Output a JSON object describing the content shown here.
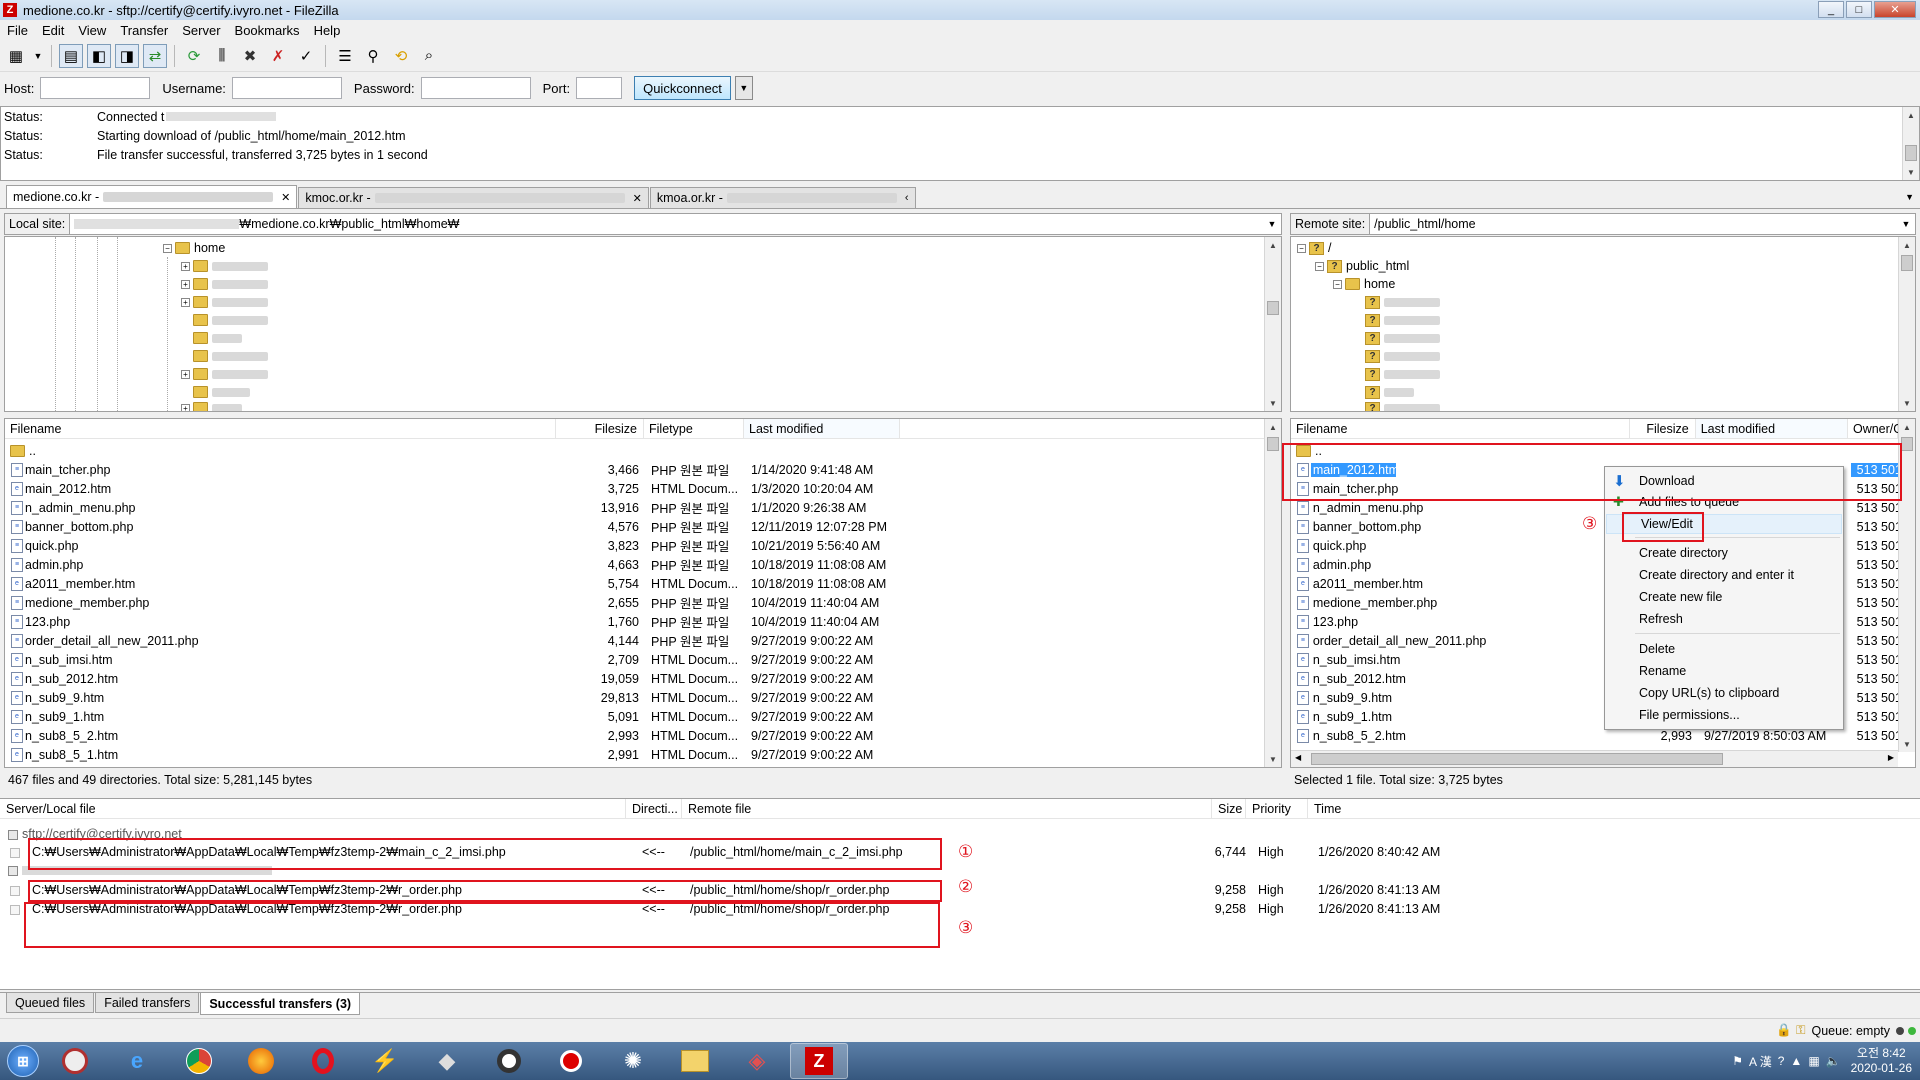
{
  "window": {
    "title": "medione.co.kr - sftp://certify@certify.ivyro.net - FileZilla",
    "app_icon": "filezilla-icon",
    "controls": [
      "_",
      "□",
      "✕"
    ]
  },
  "menu": [
    "File",
    "Edit",
    "View",
    "Transfer",
    "Server",
    "Bookmarks",
    "Help"
  ],
  "quickconnect": {
    "host_label": "Host:",
    "username_label": "Username:",
    "password_label": "Password:",
    "port_label": "Port:",
    "button": "Quickconnect",
    "dropdown": "▼"
  },
  "message_log": [
    {
      "k": "Status:",
      "v": "Connected t"
    },
    {
      "k": "Status:",
      "v": "Starting download of /public_html/home/main_2012.htm"
    },
    {
      "k": "Status:",
      "v": "File transfer successful, transferred 3,725 bytes in 1 second"
    }
  ],
  "site_tabs": [
    {
      "label": "medione.co.kr -",
      "close": "✕"
    },
    {
      "label": "kmoc.or.kr -",
      "close": "✕"
    },
    {
      "label": "kmoa.or.kr -",
      "close": "‹"
    }
  ],
  "local": {
    "site_label": "Local site:",
    "site_path": "₩medione.co.kr₩public_html₩home₩",
    "tree_home": "home",
    "headers": [
      "Filename",
      "Filesize",
      "Filetype",
      "Last modified"
    ],
    "parent": "..",
    "files": [
      {
        "name": "main_tcher.php",
        "size": "3,466",
        "type": "PHP 원본 파일",
        "modified": "1/14/2020 9:41:48 AM"
      },
      {
        "name": "main_2012.htm",
        "size": "3,725",
        "type": "HTML Docum...",
        "modified": "1/3/2020 10:20:04 AM"
      },
      {
        "name": "n_admin_menu.php",
        "size": "13,916",
        "type": "PHP 원본 파일",
        "modified": "1/1/2020 9:26:38 AM"
      },
      {
        "name": "banner_bottom.php",
        "size": "4,576",
        "type": "PHP 원본 파일",
        "modified": "12/11/2019 12:07:28 PM"
      },
      {
        "name": "quick.php",
        "size": "3,823",
        "type": "PHP 원본 파일",
        "modified": "10/21/2019 5:56:40 AM"
      },
      {
        "name": "admin.php",
        "size": "4,663",
        "type": "PHP 원본 파일",
        "modified": "10/18/2019 11:08:08 AM"
      },
      {
        "name": "a2011_member.htm",
        "size": "5,754",
        "type": "HTML Docum...",
        "modified": "10/18/2019 11:08:08 AM"
      },
      {
        "name": "medione_member.php",
        "size": "2,655",
        "type": "PHP 원본 파일",
        "modified": "10/4/2019 11:40:04 AM"
      },
      {
        "name": "123.php",
        "size": "1,760",
        "type": "PHP 원본 파일",
        "modified": "10/4/2019 11:40:04 AM"
      },
      {
        "name": "order_detail_all_new_2011.php",
        "size": "4,144",
        "type": "PHP 원본 파일",
        "modified": "9/27/2019 9:00:22 AM"
      },
      {
        "name": "n_sub_imsi.htm",
        "size": "2,709",
        "type": "HTML Docum...",
        "modified": "9/27/2019 9:00:22 AM"
      },
      {
        "name": "n_sub_2012.htm",
        "size": "19,059",
        "type": "HTML Docum...",
        "modified": "9/27/2019 9:00:22 AM"
      },
      {
        "name": "n_sub9_9.htm",
        "size": "29,813",
        "type": "HTML Docum...",
        "modified": "9/27/2019 9:00:22 AM"
      },
      {
        "name": "n_sub9_1.htm",
        "size": "5,091",
        "type": "HTML Docum...",
        "modified": "9/27/2019 9:00:22 AM"
      },
      {
        "name": "n_sub8_5_2.htm",
        "size": "2,993",
        "type": "HTML Docum...",
        "modified": "9/27/2019 9:00:22 AM"
      },
      {
        "name": "n_sub8_5_1.htm",
        "size": "2,991",
        "type": "HTML Docum...",
        "modified": "9/27/2019 9:00:22 AM"
      }
    ],
    "status": "467 files and 49 directories. Total size: 5,281,145 bytes"
  },
  "remote": {
    "site_label": "Remote site:",
    "site_path": "/public_html/home",
    "tree": {
      "root": "/",
      "public_html": "public_html",
      "home": "home"
    },
    "headers": [
      "Filename",
      "Filesize",
      "Last modified",
      "Owner/G"
    ],
    "parent": "..",
    "files": [
      {
        "name": "main_2012.htm",
        "owner": "513 501"
      },
      {
        "name": "main_tcher.php",
        "owner": "513 501"
      },
      {
        "name": "n_admin_menu.php",
        "owner": "513 501"
      },
      {
        "name": "banner_bottom.php",
        "owner": "513 501"
      },
      {
        "name": "quick.php",
        "owner": "513 501"
      },
      {
        "name": "admin.php",
        "owner": "513 501"
      },
      {
        "name": "a2011_member.htm",
        "owner": "513 501"
      },
      {
        "name": "medione_member.php",
        "owner": "513 501"
      },
      {
        "name": "123.php",
        "owner": "513 501"
      },
      {
        "name": "order_detail_all_new_2011.php",
        "owner": "513 501"
      },
      {
        "name": "n_sub_imsi.htm",
        "owner": "513 501"
      },
      {
        "name": "n_sub_2012.htm",
        "owner": "513 501"
      },
      {
        "name": "n_sub9_9.htm",
        "owner": "513 501"
      },
      {
        "name": "n_sub9_1.htm",
        "owner": "513 501"
      },
      {
        "name": "n_sub8_5_2.htm",
        "owner": "513 501",
        "size": "2,993",
        "modified": "9/27/2019 8:50:03 AM"
      }
    ],
    "status": "Selected 1 file. Total size: 3,725 bytes"
  },
  "context_menu": {
    "items": [
      "Download",
      "Add files to queue",
      "View/Edit",
      "Create directory",
      "Create directory and enter it",
      "Create new file",
      "Refresh",
      "Delete",
      "Rename",
      "Copy URL(s) to clipboard",
      "File permissions..."
    ]
  },
  "queue": {
    "headers": [
      "Server/Local file",
      "Directi...",
      "Remote file",
      "Size",
      "Priority",
      "Time"
    ],
    "server": "sftp://certify@certify.ivyro.net",
    "rows": [
      {
        "local": "C:₩Users₩Administrator₩AppData₩Local₩Temp₩fz3temp-2₩main_c_2_imsi.php",
        "dir": "<<--",
        "remote": "/public_html/home/main_c_2_imsi.php",
        "size": "6,744",
        "priority": "High",
        "time": "1/26/2020 8:40:42 AM"
      },
      {
        "local": "C:₩Users₩Administrator₩AppData₩Local₩Temp₩fz3temp-2₩r_order.php",
        "dir": "<<--",
        "remote": "/public_html/home/shop/r_order.php",
        "size": "9,258",
        "priority": "High",
        "time": "1/26/2020 8:41:13 AM"
      },
      {
        "local": "C:₩Users₩Administrator₩AppData₩Local₩Temp₩fz3temp-2₩r_order.php",
        "dir": "<<--",
        "remote": "/public_html/home/shop/r_order.php",
        "size": "9,258",
        "priority": "High",
        "time": "1/26/2020 8:41:13 AM"
      }
    ]
  },
  "annotations": {
    "n1": "①",
    "n2": "②",
    "n3": "③"
  },
  "bottom_tabs": [
    "Queued files",
    "Failed transfers",
    "Successful transfers (3)"
  ],
  "statusline": {
    "queue": "Queue: empty"
  },
  "taskbar": {
    "apps": [
      "chrome-like-icon",
      "ie-icon",
      "chrome-icon",
      "firefox-icon",
      "opera-icon",
      "sublime-icon",
      "virtualbox-icon",
      "obs-icon",
      "record-icon",
      "network-icon",
      "explorer-icon",
      "paint-icon",
      "filezilla-icon"
    ],
    "tray": {
      "ime": "A 漢",
      "time": "오전 8:42",
      "date": "2020-01-26"
    }
  }
}
